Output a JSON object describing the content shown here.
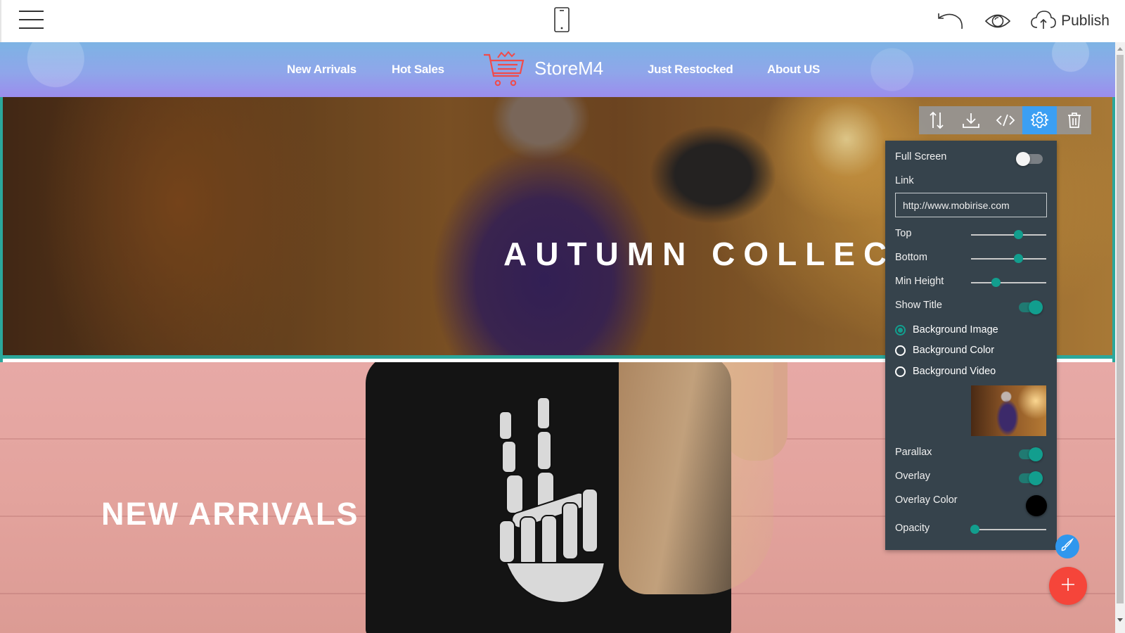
{
  "appbar": {
    "menu_icon": "hamburger-menu-icon",
    "device_icon": "mobile-phone-icon",
    "undo_icon": "undo-icon",
    "preview_icon": "eye-icon",
    "publish_icon": "cloud-upload-icon",
    "publish_label": "Publish"
  },
  "site": {
    "nav_links": [
      "New Arrivals",
      "Hot Sales",
      "Just Restocked",
      "About US"
    ],
    "brand_name": "StoreM4",
    "brand_icon": "shopping-cart-icon",
    "brand_color": "#f04b4b"
  },
  "hero": {
    "title": "AUTUMN COLLECT",
    "selection_color": "#2ba79b"
  },
  "block_toolbar": {
    "buttons": [
      {
        "icon": "reorder-arrows-icon",
        "active": false
      },
      {
        "icon": "download-icon",
        "active": false
      },
      {
        "icon": "code-icon",
        "active": false
      },
      {
        "icon": "gear-icon",
        "active": true
      },
      {
        "icon": "trash-icon",
        "active": false
      }
    ],
    "active_color": "#3b9ff3"
  },
  "settings": {
    "full_screen": {
      "label": "Full Screen",
      "on": false
    },
    "link": {
      "label": "Link",
      "value": "http://www.mobirise.com"
    },
    "top": {
      "label": "Top",
      "value_pct": 63
    },
    "bottom": {
      "label": "Bottom",
      "value_pct": 63
    },
    "min_height": {
      "label": "Min Height",
      "value_pct": 33
    },
    "show_title": {
      "label": "Show Title",
      "on": true
    },
    "background_options": [
      {
        "label": "Background Image",
        "checked": true
      },
      {
        "label": "Background Color",
        "checked": false
      },
      {
        "label": "Background Video",
        "checked": false
      }
    ],
    "parallax": {
      "label": "Parallax",
      "on": true
    },
    "overlay": {
      "label": "Overlay",
      "on": true
    },
    "overlay_color": {
      "label": "Overlay Color",
      "value": "#000000"
    },
    "opacity": {
      "label": "Opacity",
      "value_pct": 5
    },
    "accent_color": "#129e8e"
  },
  "arrivals": {
    "title": "NEW ARRIVALS"
  },
  "fabs": {
    "brush_icon": "paint-brush-icon",
    "brush_color": "#2f97ee",
    "add_icon": "plus-icon",
    "add_color": "#f5453a"
  }
}
